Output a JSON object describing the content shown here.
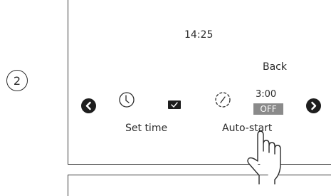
{
  "step": {
    "number": "2"
  },
  "display": {
    "clock": "14:25",
    "back_label": "Back",
    "duration": "3:00",
    "status_badge": "OFF",
    "set_time_label": "Set time",
    "auto_start_label": "Auto-start"
  },
  "icons": {
    "left": "chevron-left-icon",
    "right": "chevron-right-icon",
    "clock": "clock-icon",
    "check": "check-icon",
    "dial": "timer-dial-icon",
    "hand": "pointing-hand-icon"
  },
  "colors": {
    "nav_button": "#1e1e1e",
    "badge_bg": "#8a8a8a",
    "text": "#2b2b2b"
  }
}
